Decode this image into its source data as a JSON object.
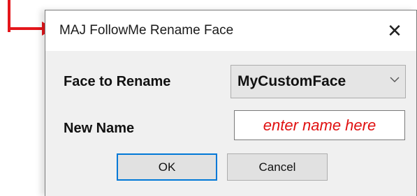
{
  "dialog": {
    "title": "MAJ FollowMe Rename Face",
    "close_glyph": "✕",
    "face_label": "Face to Rename",
    "face_value": "MyCustomFace",
    "name_label": "New Name",
    "name_placeholder": "enter name here",
    "ok_label": "OK",
    "cancel_label": "Cancel"
  },
  "icons": {
    "close": "close-icon",
    "dropdown": "chevron-down-icon",
    "annotation": "annotation-arrow-icon"
  },
  "colors": {
    "annotation": "#e4161b",
    "placeholder_text": "#e01010",
    "default_button_border": "#0078d7"
  }
}
